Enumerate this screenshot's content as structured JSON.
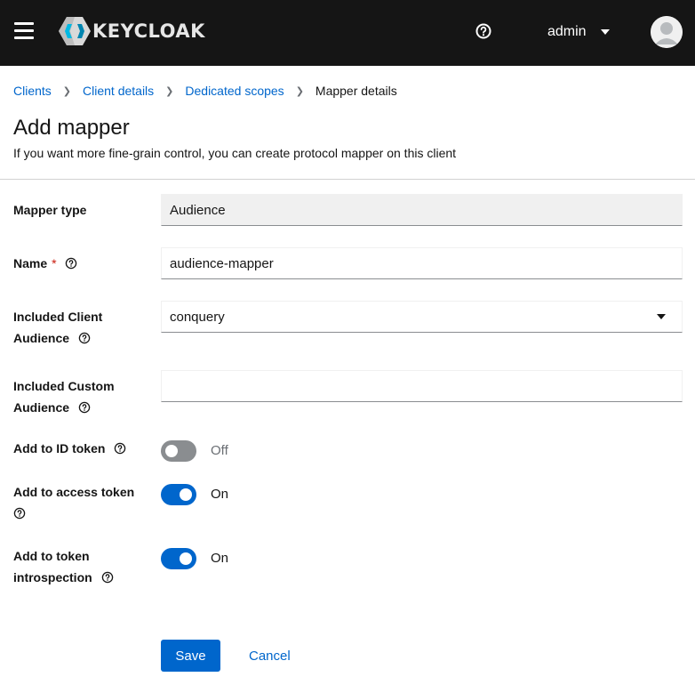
{
  "header": {
    "brand": "KEYCLOAK",
    "user": "admin"
  },
  "breadcrumb": {
    "items": [
      "Clients",
      "Client details",
      "Dedicated scopes"
    ],
    "current": "Mapper details"
  },
  "page": {
    "title": "Add mapper",
    "description": "If you want more fine-grain control, you can create protocol mapper on this client"
  },
  "form": {
    "mapper_type": {
      "label": "Mapper type",
      "value": "Audience"
    },
    "name": {
      "label": "Name",
      "required_mark": "*",
      "value": "audience-mapper"
    },
    "included_client_audience": {
      "label_line1": "Included Client",
      "label_line2": "Audience",
      "value": "conquery"
    },
    "included_custom_audience": {
      "label_line1": "Included Custom",
      "label_line2": "Audience",
      "value": ""
    },
    "add_to_id_token": {
      "label": "Add to ID token",
      "state": "Off"
    },
    "add_to_access_token": {
      "label": "Add to access token",
      "state": "On"
    },
    "add_to_token_introspection": {
      "label_line1": "Add to token",
      "label_line2": "introspection",
      "state": "On"
    }
  },
  "actions": {
    "save": "Save",
    "cancel": "Cancel"
  },
  "colors": {
    "masthead": "#151515",
    "primary": "#0066cc",
    "required": "#c9190b",
    "switch_off": "#8a8d90"
  },
  "icons": [
    "hamburger-icon",
    "keycloak-logo-icon",
    "help-icon",
    "chevron-down-icon",
    "avatar-icon",
    "chevron-right-icon",
    "question-circle-icon"
  ]
}
